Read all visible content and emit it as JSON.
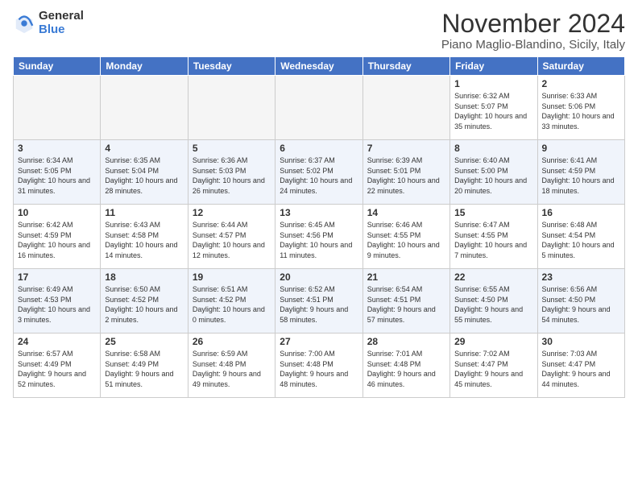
{
  "logo": {
    "general": "General",
    "blue": "Blue"
  },
  "header": {
    "month": "November 2024",
    "location": "Piano Maglio-Blandino, Sicily, Italy"
  },
  "weekdays": [
    "Sunday",
    "Monday",
    "Tuesday",
    "Wednesday",
    "Thursday",
    "Friday",
    "Saturday"
  ],
  "weeks": [
    [
      {
        "day": "",
        "empty": true
      },
      {
        "day": "",
        "empty": true
      },
      {
        "day": "",
        "empty": true
      },
      {
        "day": "",
        "empty": true
      },
      {
        "day": "",
        "empty": true
      },
      {
        "day": "1",
        "sunrise": "Sunrise: 6:32 AM",
        "sunset": "Sunset: 5:07 PM",
        "daylight": "Daylight: 10 hours and 35 minutes."
      },
      {
        "day": "2",
        "sunrise": "Sunrise: 6:33 AM",
        "sunset": "Sunset: 5:06 PM",
        "daylight": "Daylight: 10 hours and 33 minutes."
      }
    ],
    [
      {
        "day": "3",
        "sunrise": "Sunrise: 6:34 AM",
        "sunset": "Sunset: 5:05 PM",
        "daylight": "Daylight: 10 hours and 31 minutes."
      },
      {
        "day": "4",
        "sunrise": "Sunrise: 6:35 AM",
        "sunset": "Sunset: 5:04 PM",
        "daylight": "Daylight: 10 hours and 28 minutes."
      },
      {
        "day": "5",
        "sunrise": "Sunrise: 6:36 AM",
        "sunset": "Sunset: 5:03 PM",
        "daylight": "Daylight: 10 hours and 26 minutes."
      },
      {
        "day": "6",
        "sunrise": "Sunrise: 6:37 AM",
        "sunset": "Sunset: 5:02 PM",
        "daylight": "Daylight: 10 hours and 24 minutes."
      },
      {
        "day": "7",
        "sunrise": "Sunrise: 6:39 AM",
        "sunset": "Sunset: 5:01 PM",
        "daylight": "Daylight: 10 hours and 22 minutes."
      },
      {
        "day": "8",
        "sunrise": "Sunrise: 6:40 AM",
        "sunset": "Sunset: 5:00 PM",
        "daylight": "Daylight: 10 hours and 20 minutes."
      },
      {
        "day": "9",
        "sunrise": "Sunrise: 6:41 AM",
        "sunset": "Sunset: 4:59 PM",
        "daylight": "Daylight: 10 hours and 18 minutes."
      }
    ],
    [
      {
        "day": "10",
        "sunrise": "Sunrise: 6:42 AM",
        "sunset": "Sunset: 4:59 PM",
        "daylight": "Daylight: 10 hours and 16 minutes."
      },
      {
        "day": "11",
        "sunrise": "Sunrise: 6:43 AM",
        "sunset": "Sunset: 4:58 PM",
        "daylight": "Daylight: 10 hours and 14 minutes."
      },
      {
        "day": "12",
        "sunrise": "Sunrise: 6:44 AM",
        "sunset": "Sunset: 4:57 PM",
        "daylight": "Daylight: 10 hours and 12 minutes."
      },
      {
        "day": "13",
        "sunrise": "Sunrise: 6:45 AM",
        "sunset": "Sunset: 4:56 PM",
        "daylight": "Daylight: 10 hours and 11 minutes."
      },
      {
        "day": "14",
        "sunrise": "Sunrise: 6:46 AM",
        "sunset": "Sunset: 4:55 PM",
        "daylight": "Daylight: 10 hours and 9 minutes."
      },
      {
        "day": "15",
        "sunrise": "Sunrise: 6:47 AM",
        "sunset": "Sunset: 4:55 PM",
        "daylight": "Daylight: 10 hours and 7 minutes."
      },
      {
        "day": "16",
        "sunrise": "Sunrise: 6:48 AM",
        "sunset": "Sunset: 4:54 PM",
        "daylight": "Daylight: 10 hours and 5 minutes."
      }
    ],
    [
      {
        "day": "17",
        "sunrise": "Sunrise: 6:49 AM",
        "sunset": "Sunset: 4:53 PM",
        "daylight": "Daylight: 10 hours and 3 minutes."
      },
      {
        "day": "18",
        "sunrise": "Sunrise: 6:50 AM",
        "sunset": "Sunset: 4:52 PM",
        "daylight": "Daylight: 10 hours and 2 minutes."
      },
      {
        "day": "19",
        "sunrise": "Sunrise: 6:51 AM",
        "sunset": "Sunset: 4:52 PM",
        "daylight": "Daylight: 10 hours and 0 minutes."
      },
      {
        "day": "20",
        "sunrise": "Sunrise: 6:52 AM",
        "sunset": "Sunset: 4:51 PM",
        "daylight": "Daylight: 9 hours and 58 minutes."
      },
      {
        "day": "21",
        "sunrise": "Sunrise: 6:54 AM",
        "sunset": "Sunset: 4:51 PM",
        "daylight": "Daylight: 9 hours and 57 minutes."
      },
      {
        "day": "22",
        "sunrise": "Sunrise: 6:55 AM",
        "sunset": "Sunset: 4:50 PM",
        "daylight": "Daylight: 9 hours and 55 minutes."
      },
      {
        "day": "23",
        "sunrise": "Sunrise: 6:56 AM",
        "sunset": "Sunset: 4:50 PM",
        "daylight": "Daylight: 9 hours and 54 minutes."
      }
    ],
    [
      {
        "day": "24",
        "sunrise": "Sunrise: 6:57 AM",
        "sunset": "Sunset: 4:49 PM",
        "daylight": "Daylight: 9 hours and 52 minutes."
      },
      {
        "day": "25",
        "sunrise": "Sunrise: 6:58 AM",
        "sunset": "Sunset: 4:49 PM",
        "daylight": "Daylight: 9 hours and 51 minutes."
      },
      {
        "day": "26",
        "sunrise": "Sunrise: 6:59 AM",
        "sunset": "Sunset: 4:48 PM",
        "daylight": "Daylight: 9 hours and 49 minutes."
      },
      {
        "day": "27",
        "sunrise": "Sunrise: 7:00 AM",
        "sunset": "Sunset: 4:48 PM",
        "daylight": "Daylight: 9 hours and 48 minutes."
      },
      {
        "day": "28",
        "sunrise": "Sunrise: 7:01 AM",
        "sunset": "Sunset: 4:48 PM",
        "daylight": "Daylight: 9 hours and 46 minutes."
      },
      {
        "day": "29",
        "sunrise": "Sunrise: 7:02 AM",
        "sunset": "Sunset: 4:47 PM",
        "daylight": "Daylight: 9 hours and 45 minutes."
      },
      {
        "day": "30",
        "sunrise": "Sunrise: 7:03 AM",
        "sunset": "Sunset: 4:47 PM",
        "daylight": "Daylight: 9 hours and 44 minutes."
      }
    ]
  ]
}
